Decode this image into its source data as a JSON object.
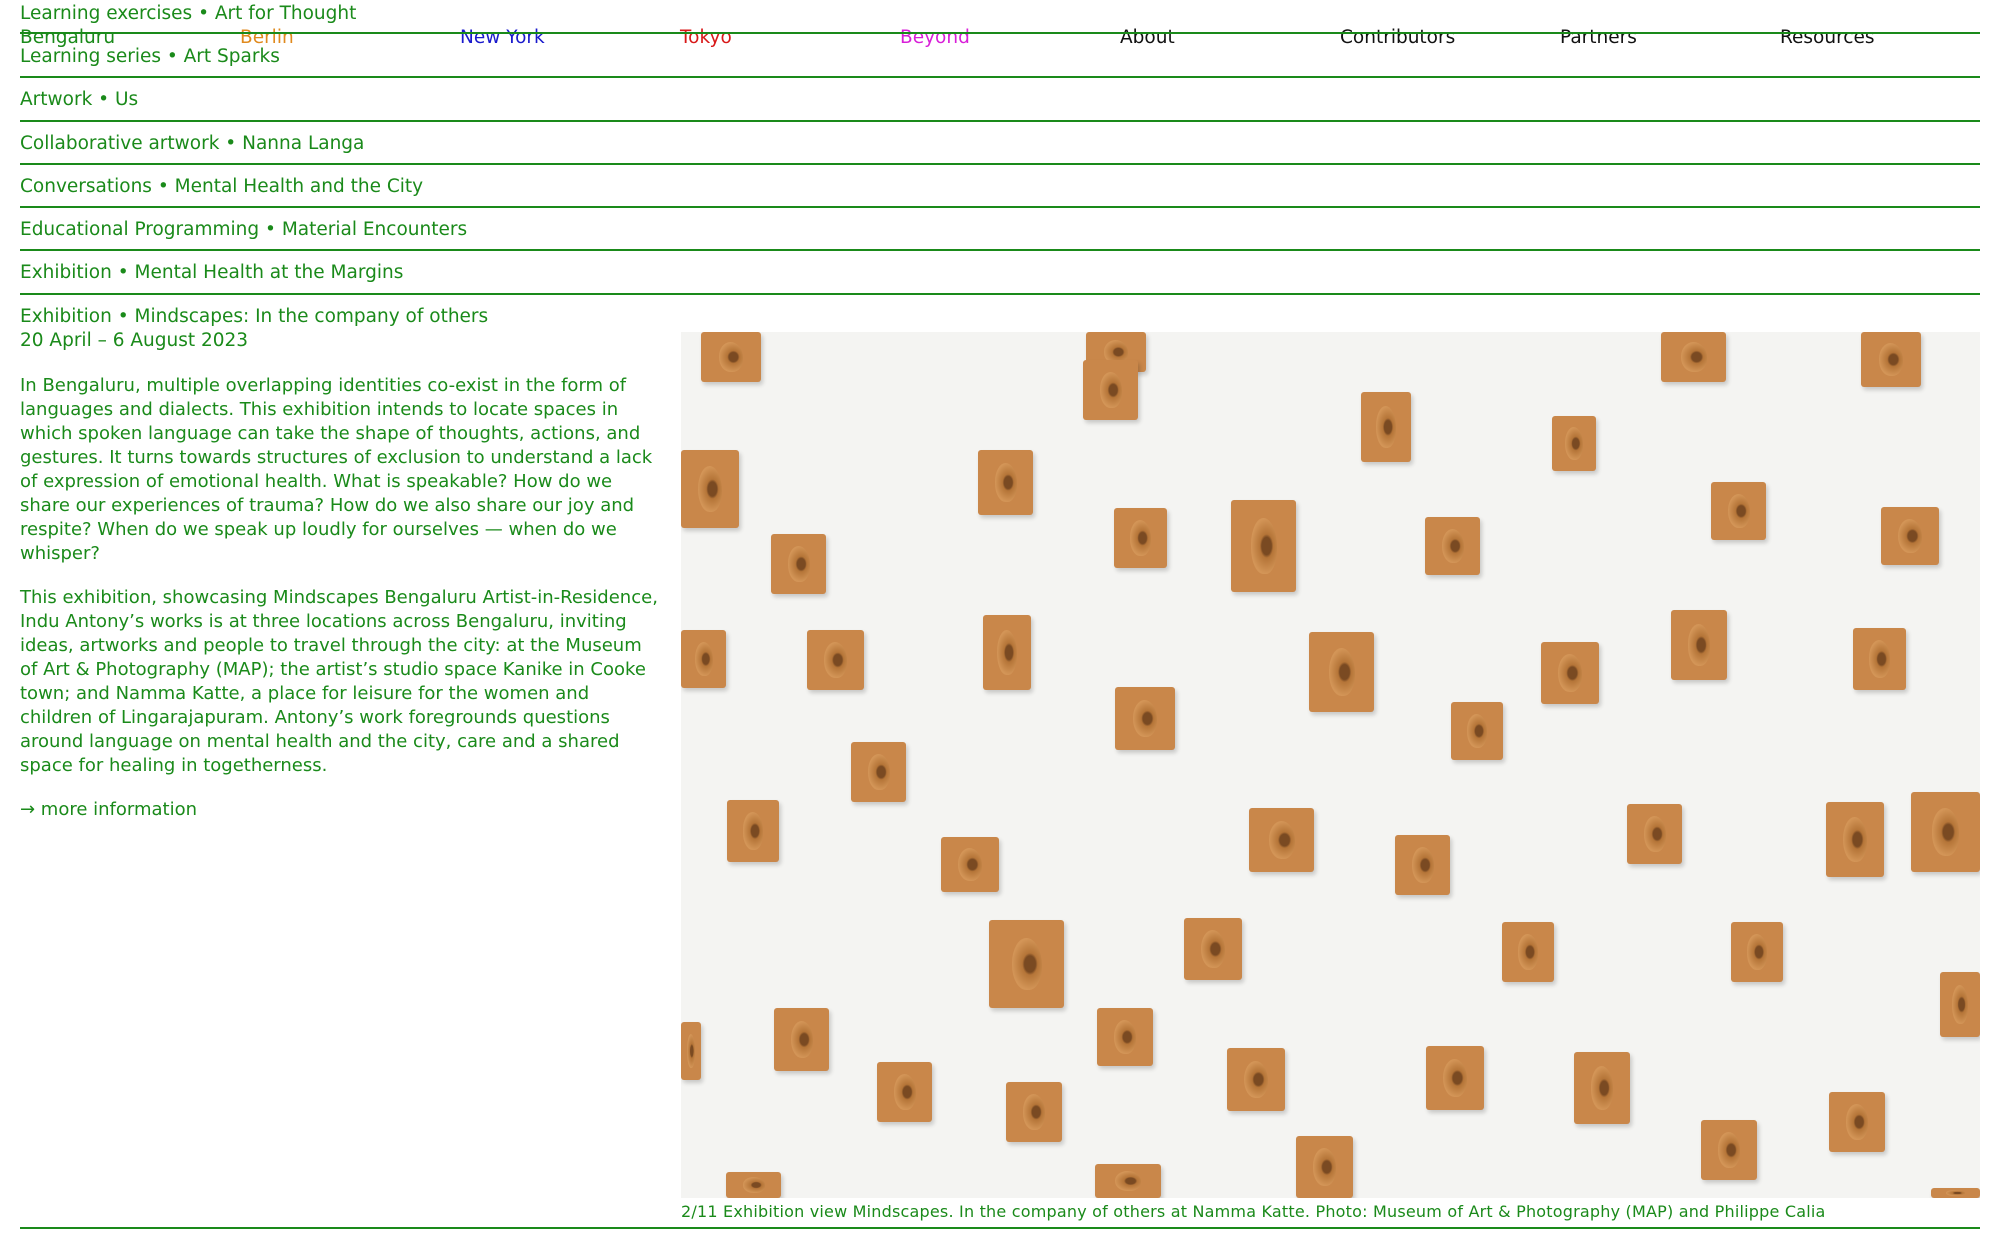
{
  "nav": {
    "items": [
      {
        "label": "Bengaluru",
        "color": "#1a8a1a"
      },
      {
        "label": "Berlin",
        "color": "#e08a1e"
      },
      {
        "label": "New York",
        "color": "#1a1acc"
      },
      {
        "label": "Tokyo",
        "color": "#d81818"
      },
      {
        "label": "Beyond",
        "color": "#d81fd8"
      },
      {
        "label": "About",
        "color": "#111111"
      },
      {
        "label": "Contributors",
        "color": "#111111"
      },
      {
        "label": "Partners",
        "color": "#111111"
      },
      {
        "label": "Resources",
        "color": "#111111"
      }
    ]
  },
  "programs": [
    "Learning exercises • Art for Thought",
    "Learning series • Art Sparks",
    "Artwork • Us",
    "Collaborative artwork • Nanna Langa",
    "Conversations • Mental Health and the City",
    "Educational Programming • Material Encounters",
    "Exhibition • Mental Health at the Margins"
  ],
  "exhibition": {
    "title": "Exhibition • Mindscapes: In the company of others",
    "dates": "20 April – 6 August 2023",
    "paragraph1": "In Bengaluru, multiple overlapping identities co-exist in the form of languages and dialects. This exhibition intends to locate spaces in which spoken language can take the shape of thoughts, actions, and gestures. It turns towards structures of exclusion to understand a lack of expression of emotional health. What is speakable? How do we share our experiences of trauma? How do we also share our joy and respite? When do we speak up loudly for ourselves — when do we whisper?",
    "paragraph2": "This exhibition, showcasing Mindscapes Bengaluru Artist-in-Residence, Indu Antony’s works is at three locations across Bengaluru, inviting ideas, artworks and people to travel through the city: at the Museum of Art & Photography (MAP); the artist’s studio space Kanike in Cooke town; and Namma Katte, a place for leisure for the women and children of Lingarajapuram. Antony’s work foregrounds questions around language on mental health and the city, care and a shared space for healing in togetherness.",
    "more_link": "→ more information"
  },
  "gallery": {
    "caption": "2/11 Exhibition view Mindscapes. In the company of others at Namma Katte. Photo: Museum of Art & Photography (MAP) and Philippe Calia"
  },
  "colors": {
    "accent": "#1a8a1a",
    "terracotta": "#c9874a"
  }
}
